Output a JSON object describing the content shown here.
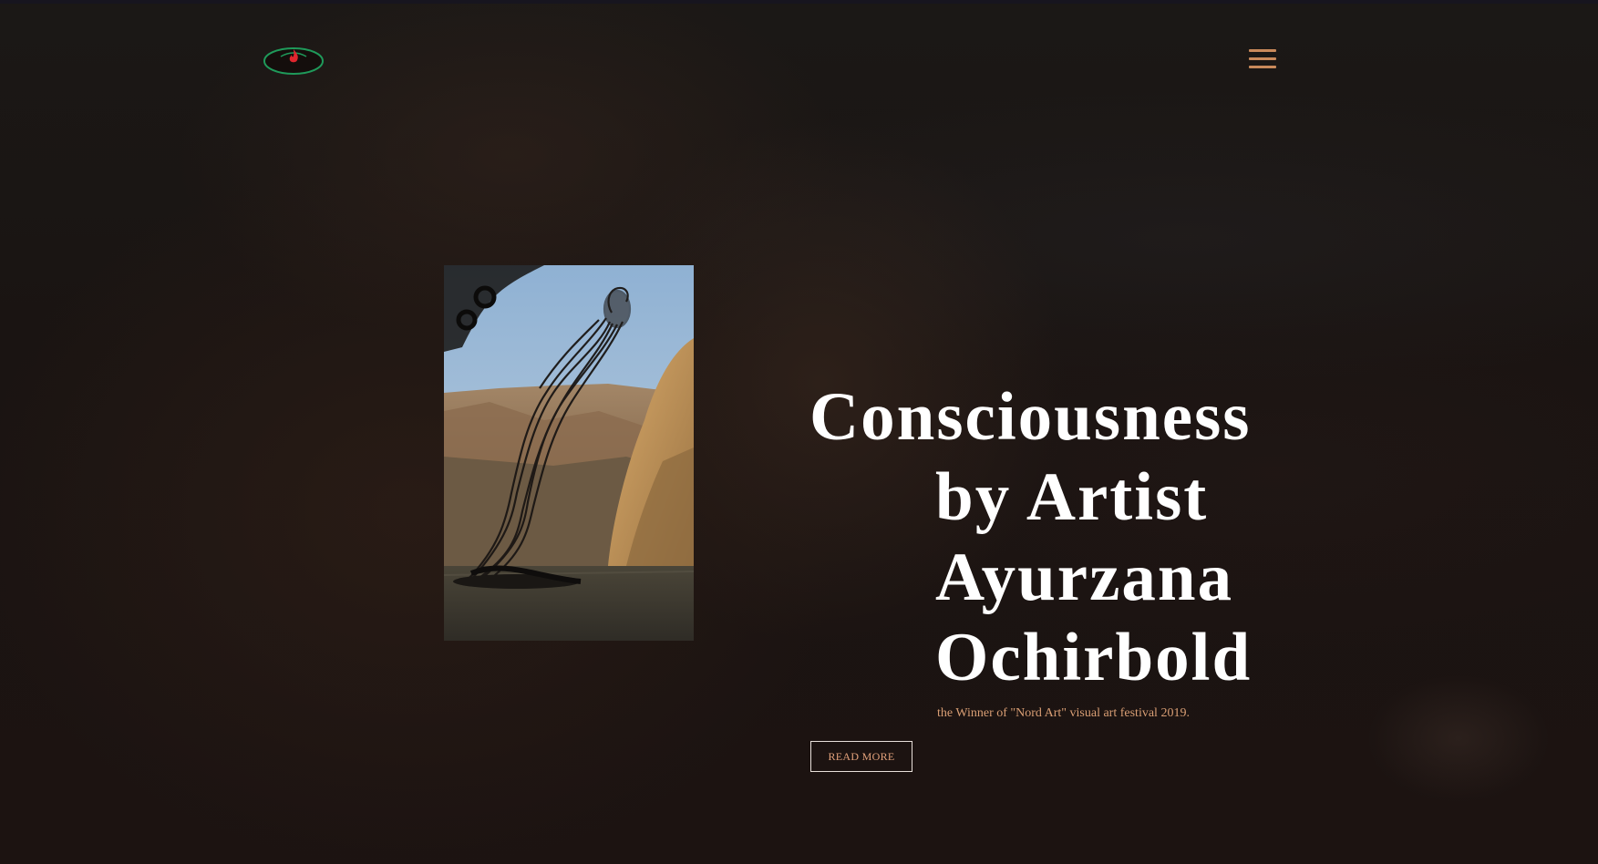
{
  "header": {
    "logo_icon": "flame-bowl-logo-icon",
    "menu_icon": "hamburger-menu-icon"
  },
  "hero": {
    "title_line1": "Consciousness",
    "title_line2": "by Artist",
    "title_line3": "Ayurzana",
    "title_line4": "Ochirbold",
    "subtitle": "the Winner of \"Nord Art\" visual art festival 2019.",
    "read_more_label": "READ MORE"
  },
  "artwork": {
    "description_icon": "wire-sculpture-photo"
  },
  "colors": {
    "accent": "#c9895a",
    "subtitle": "#d99e74",
    "logo_ring": "#1f9a5a",
    "logo_flame": "#e0262e",
    "title": "#ffffff"
  }
}
